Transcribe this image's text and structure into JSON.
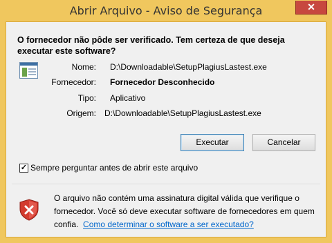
{
  "window": {
    "title": "Abrir Arquivo - Aviso de Segurança",
    "close_glyph": "✕"
  },
  "question": "O fornecedor não pôde ser verificado. Tem certeza de que deseja executar este software?",
  "details": [
    {
      "label": "Nome:",
      "value": "D:\\Downloadable\\SetupPlagiusLastest.exe",
      "bold": false
    },
    {
      "label": "Fornecedor:",
      "value": "Fornecedor Desconhecido",
      "bold": true
    },
    {
      "label": "Tipo:",
      "value": "Aplicativo",
      "bold": false
    },
    {
      "label": "Origem:",
      "value": "D:\\Downloadable\\SetupPlagiusLastest.exe",
      "bold": false
    }
  ],
  "buttons": {
    "run": "Executar",
    "cancel": "Cancelar"
  },
  "checkbox": {
    "label": "Sempre perguntar antes de abrir este arquivo",
    "checked": true,
    "mark": "✓"
  },
  "info": {
    "text": "O arquivo não contém uma assinatura digital válida que verifique o fornecedor. Você só deve executar software de fornecedores em quem confia.",
    "link": "Como determinar o software a ser executado?"
  },
  "icons": {
    "file": "application-file-icon",
    "shield": "red-shield-warning-icon"
  },
  "colors": {
    "frame": "#f0c75e",
    "close": "#c7483f",
    "shield": "#d33b2e",
    "link": "#0066cc"
  }
}
